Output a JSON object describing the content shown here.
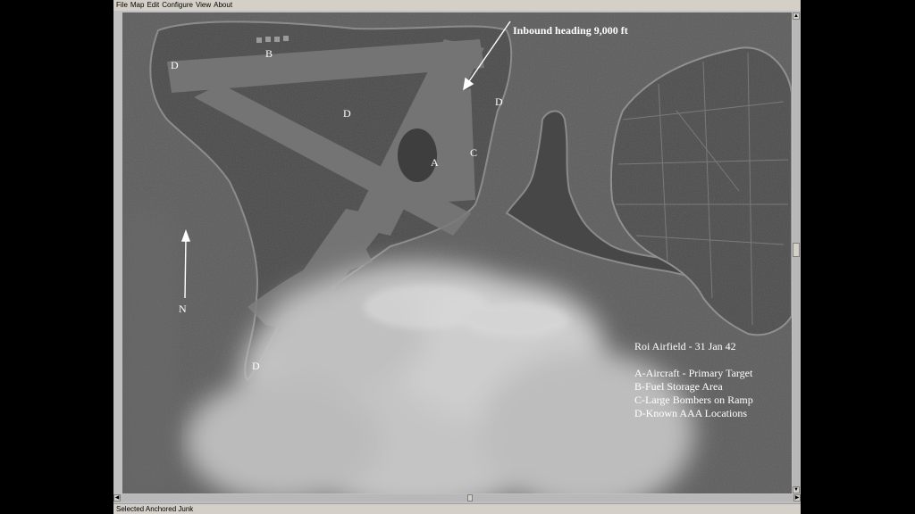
{
  "menu": {
    "items": [
      "File",
      "Map",
      "Edit",
      "Configure",
      "View",
      "About"
    ]
  },
  "map": {
    "inbound_label": "Inbound heading  9,000 ft",
    "north_label": "N",
    "markers": {
      "a": "A",
      "b": "B",
      "c": "C",
      "d1": "D",
      "d2": "D",
      "d3": "D",
      "d4": "D"
    },
    "legend": {
      "title": "Roi Airfield - 31 Jan 42",
      "items": [
        "A-Aircraft - Primary Target",
        "B-Fuel Storage Area",
        "C-Large Bombers on Ramp",
        "D-Known AAA Locations"
      ]
    }
  },
  "statusbar": {
    "text": "Selected Anchored Junk"
  },
  "colors": {
    "window_chrome": "#d4d0c8",
    "map_water": "#5a5a5a",
    "overlay_text": "#ffffff"
  }
}
